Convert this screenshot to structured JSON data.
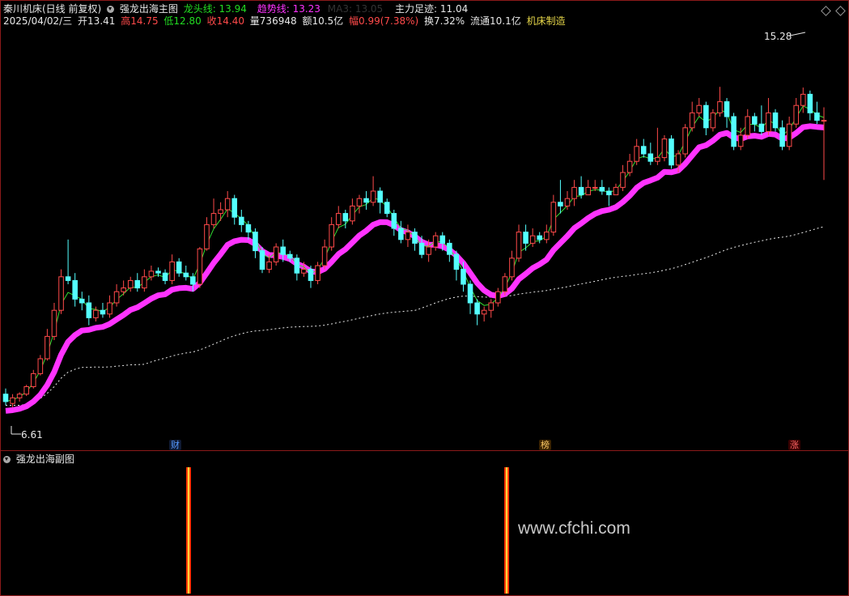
{
  "header": {
    "stock": "秦川机床(日线 前复权)",
    "indicator": "强龙出海主图",
    "dragon_label": "龙头线: 13.94",
    "trend_label": "趋势线: 13.23",
    "ma_label": "MA3: 13.05",
    "main_force_label": "主力足迹: 11.04"
  },
  "quote": {
    "date": "2025/04/02/三",
    "open": "开13.41",
    "high": "高14.75",
    "low": "低12.80",
    "close": "收14.40",
    "volume": "量736948",
    "amount": "额10.5亿",
    "change": "幅0.99(7.38%)",
    "turnover": "换7.32%",
    "float": "流通10.1亿",
    "sector": "机床制造"
  },
  "annotations": {
    "max_label": "15.28",
    "min_label": "6.61"
  },
  "markers": {
    "cai": "财",
    "bang": "榜",
    "zhang": "涨"
  },
  "sub_panel": {
    "title": "强龙出海副图"
  },
  "watermark": "www.cfchi.com",
  "colors": {
    "up": "#ff4a4a",
    "down": "#54ffff",
    "trend": "#ff33ff",
    "dragon": "#33dd33",
    "dotted": "#e8e8e8",
    "frame": "#8b1a1a"
  },
  "chart_data": {
    "type": "candlestick",
    "ylim": [
      6.0,
      16.0
    ],
    "candles": [
      [
        7.05,
        6.85,
        7.2,
        6.75
      ],
      [
        6.8,
        6.95,
        7.05,
        6.7
      ],
      [
        6.95,
        7.05,
        7.1,
        6.85
      ],
      [
        7.05,
        7.25,
        7.3,
        7.0
      ],
      [
        7.25,
        7.6,
        7.7,
        7.2
      ],
      [
        7.6,
        8.0,
        8.1,
        7.55
      ],
      [
        8.0,
        8.6,
        8.8,
        7.95
      ],
      [
        8.6,
        9.3,
        9.5,
        8.5
      ],
      [
        9.3,
        10.2,
        10.4,
        9.2
      ],
      [
        10.2,
        10.1,
        11.2,
        10.0
      ],
      [
        10.1,
        9.6,
        10.3,
        9.4
      ],
      [
        9.6,
        9.5,
        9.8,
        9.3
      ],
      [
        9.5,
        9.1,
        9.7,
        8.9
      ],
      [
        9.1,
        9.3,
        9.4,
        9.0
      ],
      [
        9.3,
        9.2,
        9.5,
        9.1
      ],
      [
        9.2,
        9.5,
        9.7,
        9.1
      ],
      [
        9.5,
        9.8,
        10.0,
        9.4
      ],
      [
        9.8,
        9.9,
        10.1,
        9.7
      ],
      [
        9.9,
        10.1,
        10.2,
        9.8
      ],
      [
        10.1,
        9.9,
        10.3,
        9.8
      ],
      [
        9.9,
        10.2,
        10.4,
        9.8
      ],
      [
        10.2,
        10.35,
        10.5,
        10.1
      ],
      [
        10.35,
        10.3,
        10.45,
        10.2
      ],
      [
        10.3,
        10.1,
        10.4,
        10.0
      ],
      [
        10.1,
        10.6,
        10.8,
        10.0
      ],
      [
        10.6,
        10.3,
        10.7,
        10.2
      ],
      [
        10.3,
        10.2,
        10.5,
        10.1
      ],
      [
        10.2,
        10.0,
        10.3,
        9.8
      ],
      [
        10.0,
        10.95,
        11.0,
        9.9
      ],
      [
        10.95,
        11.6,
        11.8,
        10.9
      ],
      [
        11.6,
        11.9,
        12.3,
        11.5
      ],
      [
        11.9,
        12.0,
        12.2,
        11.7
      ],
      [
        12.0,
        12.3,
        12.5,
        11.8
      ],
      [
        12.3,
        11.8,
        12.4,
        11.6
      ],
      [
        11.8,
        11.6,
        12.0,
        11.4
      ],
      [
        11.6,
        11.4,
        11.7,
        11.2
      ],
      [
        11.4,
        10.9,
        11.5,
        10.7
      ],
      [
        10.9,
        10.4,
        11.0,
        10.3
      ],
      [
        10.4,
        10.6,
        10.8,
        10.3
      ],
      [
        10.6,
        11.0,
        11.1,
        10.5
      ],
      [
        11.0,
        10.8,
        11.2,
        10.6
      ],
      [
        10.8,
        10.7,
        10.9,
        10.6
      ],
      [
        10.7,
        10.3,
        10.8,
        10.1
      ],
      [
        10.3,
        10.4,
        10.6,
        10.2
      ],
      [
        10.4,
        10.1,
        10.5,
        9.9
      ],
      [
        10.1,
        10.5,
        10.6,
        10.0
      ],
      [
        10.5,
        11.0,
        11.2,
        10.4
      ],
      [
        11.0,
        11.6,
        11.8,
        10.9
      ],
      [
        11.6,
        11.9,
        12.1,
        11.5
      ],
      [
        11.9,
        11.7,
        12.0,
        11.5
      ],
      [
        11.7,
        12.1,
        12.3,
        11.6
      ],
      [
        12.1,
        12.3,
        12.4,
        11.9
      ],
      [
        12.3,
        12.2,
        12.5,
        12.0
      ],
      [
        12.2,
        12.5,
        12.9,
        12.1
      ],
      [
        12.5,
        12.2,
        12.6,
        11.9
      ],
      [
        12.2,
        11.9,
        12.3,
        11.8
      ],
      [
        11.9,
        11.5,
        12.0,
        11.3
      ],
      [
        11.5,
        11.2,
        11.7,
        11.1
      ],
      [
        11.2,
        11.4,
        11.6,
        11.0
      ],
      [
        11.4,
        11.1,
        11.5,
        10.9
      ],
      [
        11.1,
        10.8,
        11.3,
        10.7
      ],
      [
        10.8,
        11.0,
        11.2,
        10.6
      ],
      [
        11.0,
        11.3,
        11.4,
        10.9
      ],
      [
        11.3,
        11.1,
        11.4,
        10.9
      ],
      [
        11.1,
        10.8,
        11.2,
        10.6
      ],
      [
        10.8,
        10.4,
        10.9,
        10.1
      ],
      [
        10.4,
        10.0,
        10.6,
        9.8
      ],
      [
        10.0,
        9.5,
        10.1,
        9.2
      ],
      [
        9.5,
        9.2,
        9.6,
        8.9
      ],
      [
        9.2,
        9.3,
        9.4,
        9.0
      ],
      [
        9.3,
        9.5,
        9.6,
        9.1
      ],
      [
        9.5,
        9.8,
        9.9,
        9.4
      ],
      [
        9.8,
        10.2,
        10.3,
        9.7
      ],
      [
        10.2,
        10.7,
        10.9,
        10.1
      ],
      [
        10.7,
        11.4,
        11.6,
        10.6
      ],
      [
        11.4,
        11.1,
        11.6,
        10.9
      ],
      [
        11.1,
        11.3,
        11.5,
        11.0
      ],
      [
        11.3,
        11.2,
        11.4,
        11.1
      ],
      [
        11.2,
        11.4,
        11.6,
        11.1
      ],
      [
        11.4,
        12.2,
        12.4,
        11.3
      ],
      [
        12.2,
        12.1,
        12.8,
        11.9
      ],
      [
        12.1,
        12.3,
        12.5,
        12.0
      ],
      [
        12.3,
        12.6,
        12.8,
        12.1
      ],
      [
        12.6,
        12.4,
        12.9,
        12.3
      ],
      [
        12.4,
        12.6,
        12.8,
        12.4
      ],
      [
        12.6,
        12.6,
        12.8,
        12.5
      ],
      [
        12.6,
        12.5,
        12.8,
        12.4
      ],
      [
        12.5,
        12.4,
        12.6,
        12.1
      ],
      [
        12.4,
        12.6,
        12.7,
        12.4
      ],
      [
        12.6,
        13.0,
        13.2,
        12.5
      ],
      [
        13.0,
        13.3,
        13.5,
        12.9
      ],
      [
        13.3,
        13.7,
        13.9,
        13.2
      ],
      [
        13.7,
        13.5,
        13.9,
        13.4
      ],
      [
        13.5,
        13.3,
        13.8,
        13.2
      ],
      [
        13.3,
        13.4,
        14.2,
        13.2
      ],
      [
        13.4,
        13.9,
        14.0,
        13.3
      ],
      [
        13.9,
        13.2,
        14.0,
        13.1
      ],
      [
        13.2,
        13.5,
        13.6,
        13.0
      ],
      [
        13.5,
        14.2,
        14.3,
        13.4
      ],
      [
        14.2,
        14.6,
        14.9,
        14.1
      ],
      [
        14.6,
        14.8,
        15.0,
        14.5
      ],
      [
        14.8,
        14.2,
        14.9,
        14.0
      ],
      [
        14.2,
        14.6,
        14.7,
        14.1
      ],
      [
        14.6,
        14.9,
        15.3,
        14.5
      ],
      [
        14.9,
        14.5,
        15.0,
        14.2
      ],
      [
        14.5,
        13.7,
        14.6,
        13.6
      ],
      [
        13.7,
        14.0,
        14.2,
        13.6
      ],
      [
        14.0,
        14.5,
        14.7,
        13.9
      ],
      [
        14.5,
        14.3,
        14.6,
        14.1
      ],
      [
        14.3,
        14.1,
        14.8,
        14.0
      ],
      [
        14.1,
        14.6,
        15.0,
        14.0
      ],
      [
        14.6,
        14.2,
        14.7,
        14.1
      ],
      [
        14.2,
        13.7,
        14.4,
        13.6
      ],
      [
        13.7,
        14.3,
        14.5,
        13.6
      ],
      [
        14.3,
        14.8,
        15.0,
        14.2
      ],
      [
        14.8,
        15.1,
        15.28,
        14.6
      ],
      [
        15.1,
        14.6,
        15.2,
        14.4
      ],
      [
        14.6,
        14.4,
        14.9,
        14.3
      ],
      [
        14.4,
        14.4,
        14.75,
        12.8
      ]
    ],
    "signal_bars_at": [
      "财",
      "榜"
    ]
  }
}
